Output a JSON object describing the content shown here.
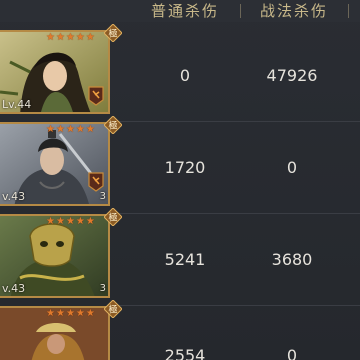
{
  "header": {
    "col_normal": "普通杀伤",
    "col_tactic": "战法杀伤"
  },
  "rows": [
    {
      "level": "Lv.44",
      "stars": 5,
      "badge": "極",
      "normal": "0",
      "tactic": "47926",
      "count": "",
      "skill": true
    },
    {
      "level": "v.43",
      "stars": 5,
      "badge": "極",
      "normal": "1720",
      "tactic": "0",
      "count": "3",
      "skill": true
    },
    {
      "level": "v.43",
      "stars": 5,
      "badge": "極",
      "normal": "5241",
      "tactic": "3680",
      "count": "3",
      "skill": false
    },
    {
      "level": "",
      "stars": 5,
      "badge": "極",
      "normal": "2554",
      "tactic": "0",
      "count": "",
      "skill": false
    }
  ],
  "colors": {
    "accent": "#c9b98a",
    "frame": "#b58a45",
    "star": "#e07a2c"
  }
}
